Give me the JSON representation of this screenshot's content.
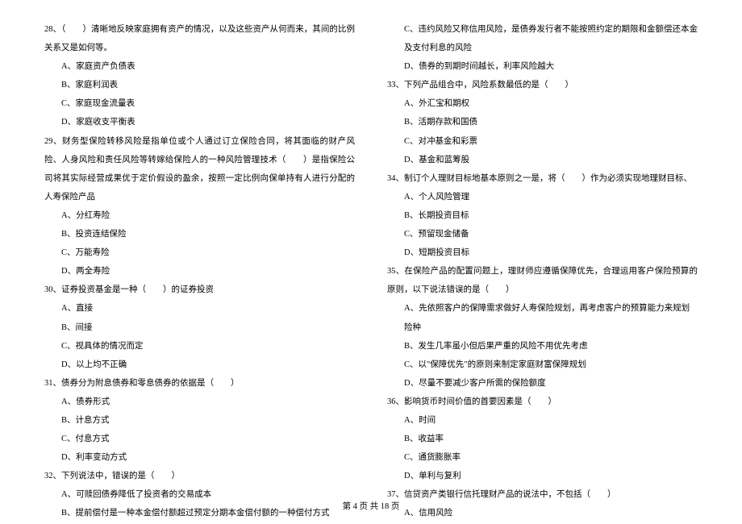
{
  "left": {
    "q28": {
      "text": "28、（　　）清晰地反映家庭拥有资产的情况，以及这些资产从何而来，其间的比例关系又是如何等。",
      "opts": [
        "A、家庭资产负债表",
        "B、家庭利润表",
        "C、家庭现金流量表",
        "D、家庭收支平衡表"
      ]
    },
    "q29": {
      "text": "29、财务型保险转移风险是指单位或个人通过订立保险合同，将其面临的财产风险、人身风险和责任风险等转嫁给保险人的一种风险管理技术（　　）是指保险公司将其实际经营成果优于定价假设的盈余，按照一定比例向保单持有人进行分配的人寿保险产品",
      "opts": [
        "A、分红寿险",
        "B、投资连结保险",
        "C、万能寿险",
        "D、两全寿险"
      ]
    },
    "q30": {
      "text": "30、证券投资基金是一种（　　）的证券投资",
      "opts": [
        "A、直接",
        "B、间接",
        "C、视具体的情况而定",
        "D、以上均不正确"
      ]
    },
    "q31": {
      "text": "31、债券分为附息债券和零息债券的依据是（　　）",
      "opts": [
        "A、债券形式",
        "B、计息方式",
        "C、付息方式",
        "D、利率变动方式"
      ]
    },
    "q32": {
      "text": "32、下列说法中，错误的是（　　）",
      "opts": [
        "A、可赎回债券降低了投资者的交易成本",
        "B、提前偿付是一种本金偿付额超过预定分期本金偿付额的一种偿付方式"
      ]
    }
  },
  "right": {
    "q32cont": {
      "opts": [
        "C、违约风险又称信用风险，是债券发行者不能按照约定的期限和金额偿还本金及支付利息的风险",
        "D、债券的到期时间越长，利率风险越大"
      ]
    },
    "q33": {
      "text": "33、下列产品组合中，风险系数最低的是（　　）",
      "opts": [
        "A、外汇宝和期权",
        "B、活期存款和国债",
        "C、对冲基金和彩票",
        "D、基金和蓝筹股"
      ]
    },
    "q34": {
      "text": "34、制订个人理财目标地基本原则之一是，将（　　）作为必须实现地理财目标、",
      "opts": [
        "A、个人风险管理",
        "B、长期投资目标",
        "C、预留现金储备",
        "D、短期投资目标"
      ]
    },
    "q35": {
      "text": "35、在保险产品的配置问题上，理财师应遵循保障优先，合理运用客户保险预算的原则，以下说法错误的是（　　）",
      "opts": [
        "A、先依照客户的保障需求做好人寿保险规划，再考虑客户的预算能力来规划险种",
        "B、发生几率虽小但后果严重的风险不用优先考虑",
        "C、以\"保障优先\"的原则来制定家庭财富保障规划",
        "D、尽量不要减少客户所需的保险额度"
      ]
    },
    "q36": {
      "text": "36、影响货币时间价值的首要因素是（　　）",
      "opts": [
        "A、时间",
        "B、收益率",
        "C、通货膨胀率",
        "D、单利与复利"
      ]
    },
    "q37": {
      "text": "37、信贷资产类银行信托理财产品的说法中，不包括（　　）",
      "opts": [
        "A、信用风险"
      ]
    }
  },
  "footer": "第 4 页 共 18 页"
}
